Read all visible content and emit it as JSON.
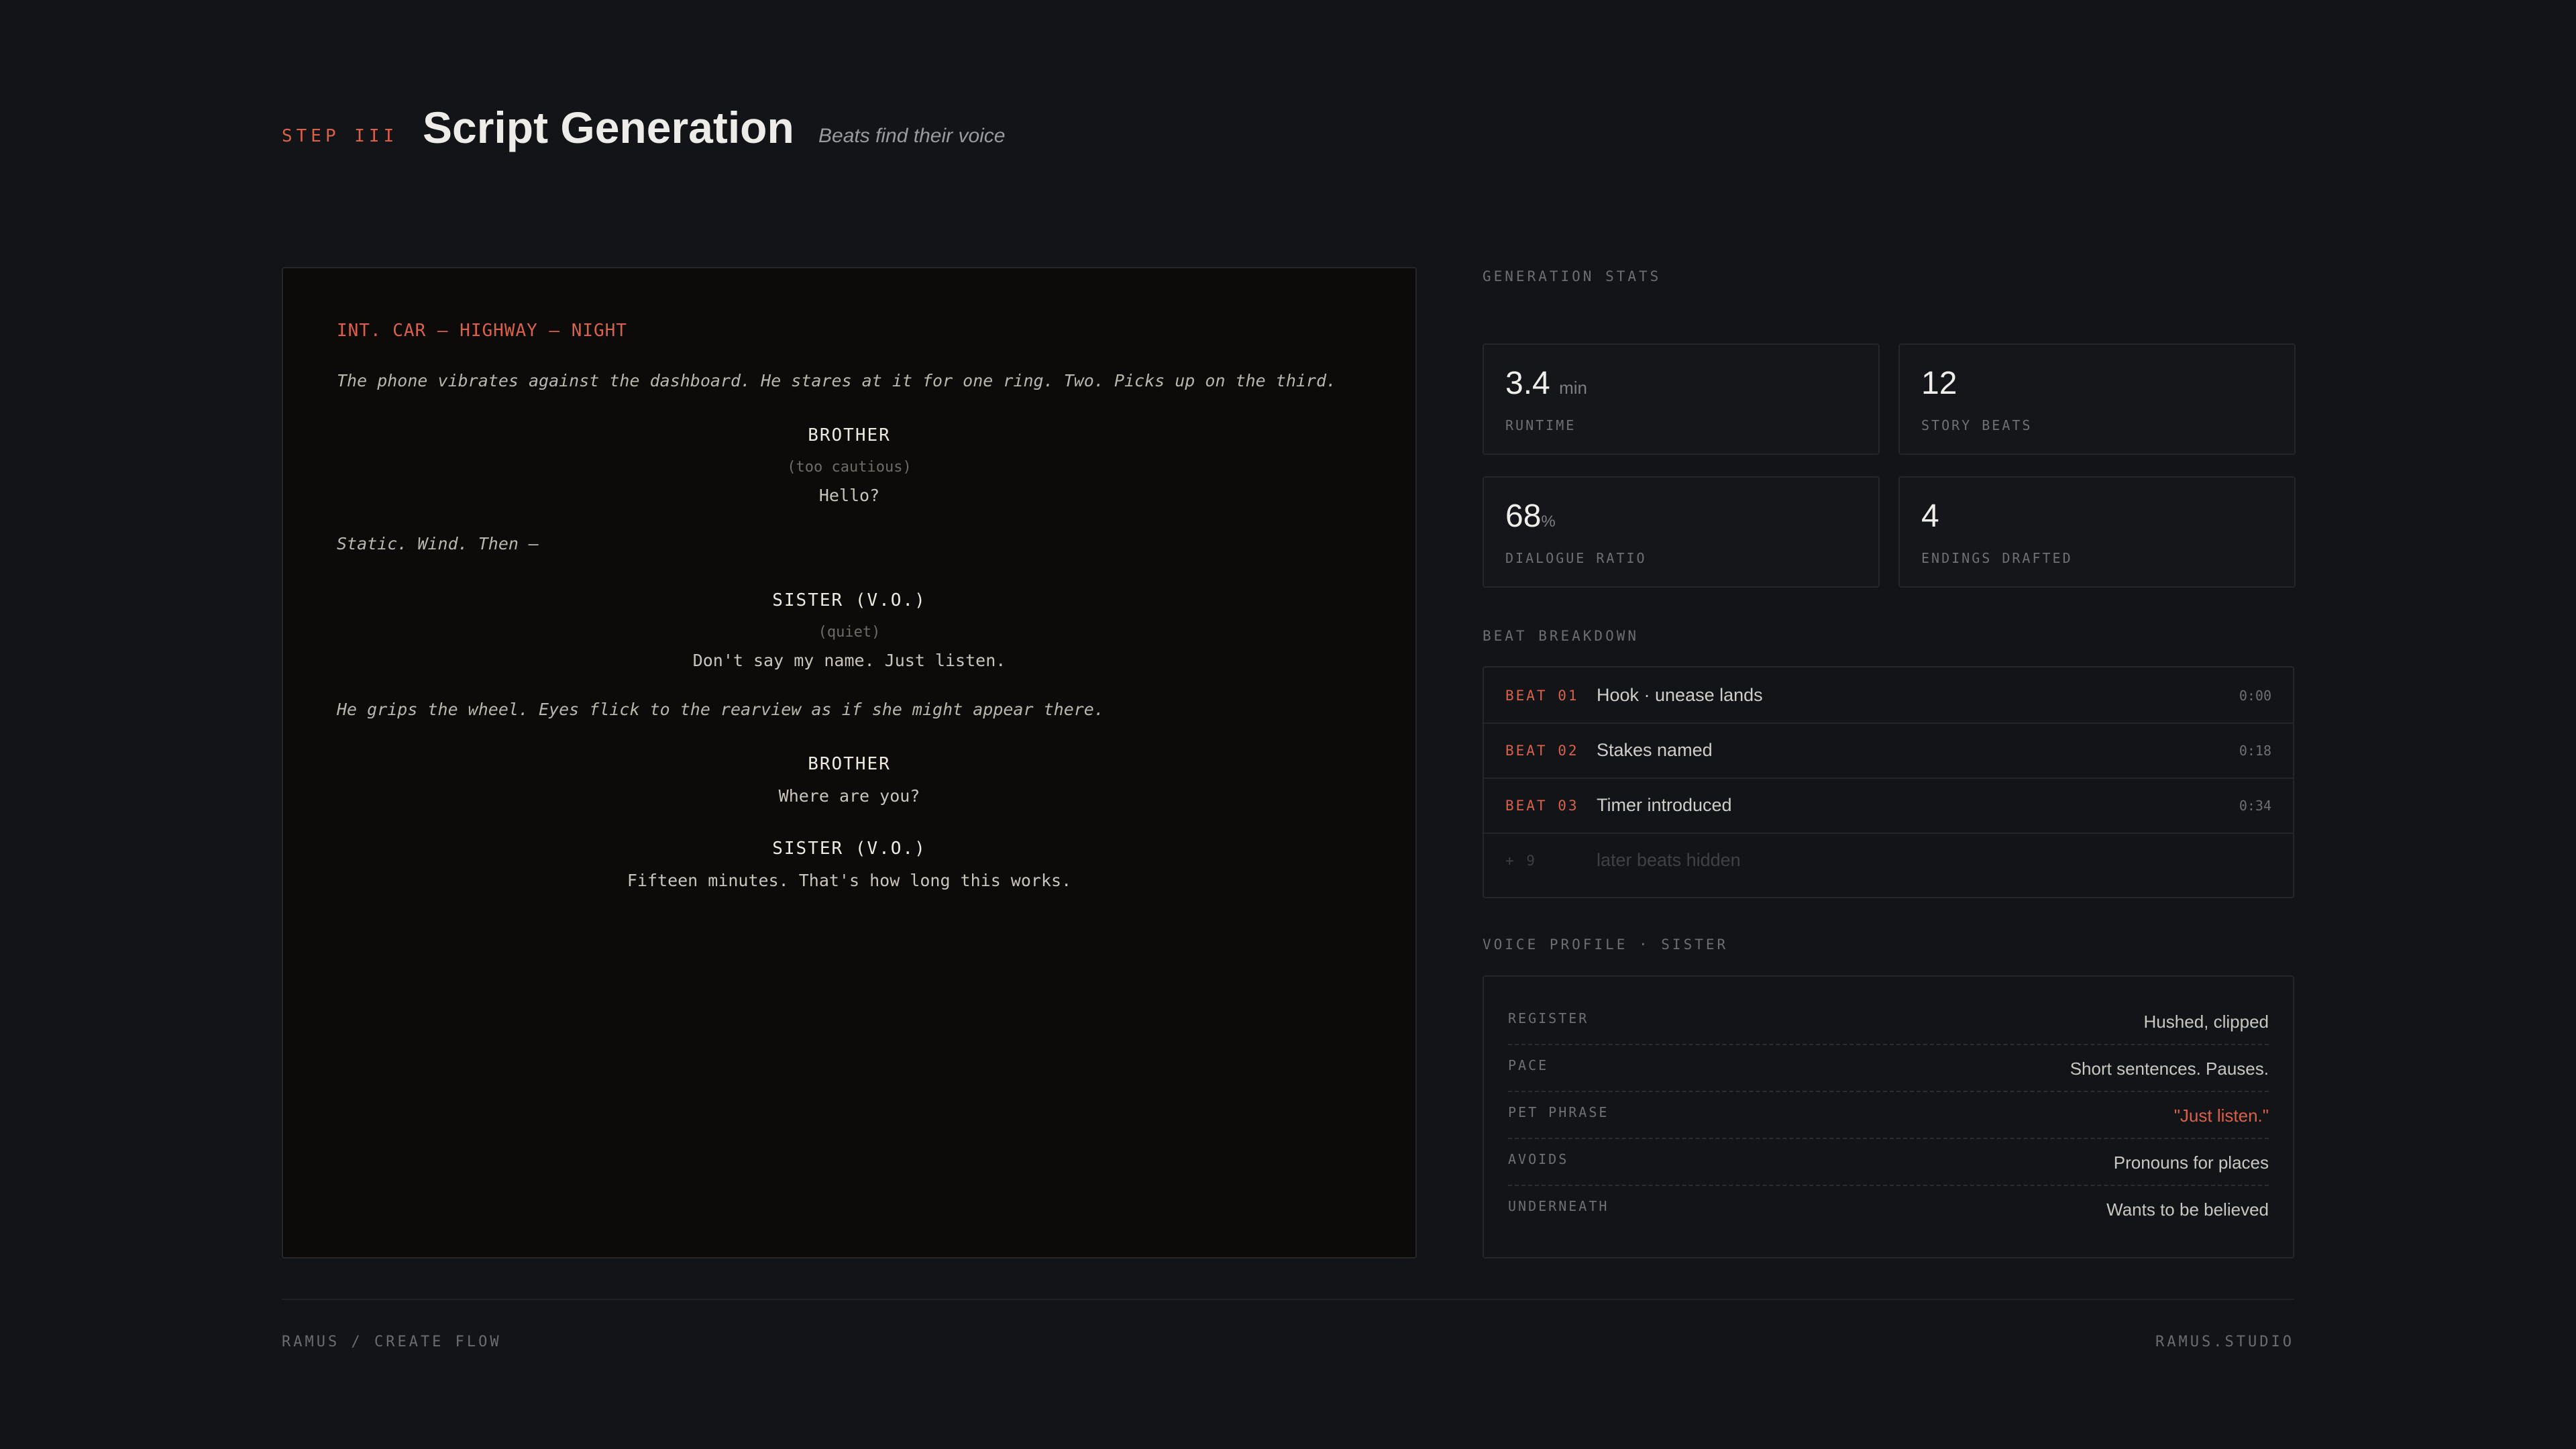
{
  "header": {
    "step": "STEP III",
    "title": "Script Generation",
    "subtitle": "Beats find their voice"
  },
  "script": {
    "slugline": "INT. CAR — HIGHWAY — NIGHT",
    "action_1": "The phone vibrates against the dashboard. He stares at it for one ring. Two. Picks up on the third.",
    "char_1": "BROTHER",
    "paren_1": "(too cautious)",
    "dialogue_1": "Hello?",
    "action_2": "Static. Wind. Then —",
    "char_2": "SISTER (V.O.)",
    "paren_2": "(quiet)",
    "dialogue_2": "Don't say my name. Just listen.",
    "action_3": "He grips the wheel. Eyes flick to the rearview as if she might appear there.",
    "char_3": "BROTHER",
    "dialogue_3": "Where are you?",
    "char_4": "SISTER (V.O.)",
    "dialogue_4": "Fifteen minutes. That's how long this works."
  },
  "stats": {
    "section_label": "GENERATION STATS",
    "runtime": {
      "value": "3.4",
      "unit": "min",
      "label": "RUNTIME"
    },
    "beats": {
      "value": "12",
      "label": "STORY BEATS"
    },
    "dialogue": {
      "value": "68",
      "unit": "%",
      "label": "DIALOGUE RATIO"
    },
    "endings": {
      "value": "4",
      "label": "ENDINGS DRAFTED"
    }
  },
  "beat_breakdown": {
    "section_label": "BEAT BREAKDOWN",
    "rows": [
      {
        "id": "BEAT 01",
        "title": "Hook · unease lands",
        "time": "0:00"
      },
      {
        "id": "BEAT 02",
        "title": "Stakes named",
        "time": "0:18"
      },
      {
        "id": "BEAT 03",
        "title": "Timer introduced",
        "time": "0:34"
      }
    ],
    "hidden": {
      "count": "+ 9",
      "label": "later beats hidden"
    }
  },
  "voice_profile": {
    "section_label": "VOICE PROFILE · SISTER",
    "rows": [
      {
        "key": "REGISTER",
        "value": "Hushed, clipped"
      },
      {
        "key": "PACE",
        "value": "Short sentences. Pauses."
      },
      {
        "key": "PET PHRASE",
        "value": "\"Just listen.\""
      },
      {
        "key": "AVOIDS",
        "value": "Pronouns for places"
      },
      {
        "key": "UNDERNEATH",
        "value": "Wants to be believed"
      }
    ]
  },
  "footer": {
    "left": "RAMUS / CREATE FLOW",
    "right": "RAMUS.STUDIO"
  },
  "colors": {
    "background": "#121418",
    "accent": "#d8614a",
    "script_panel": "#0c0b09"
  }
}
